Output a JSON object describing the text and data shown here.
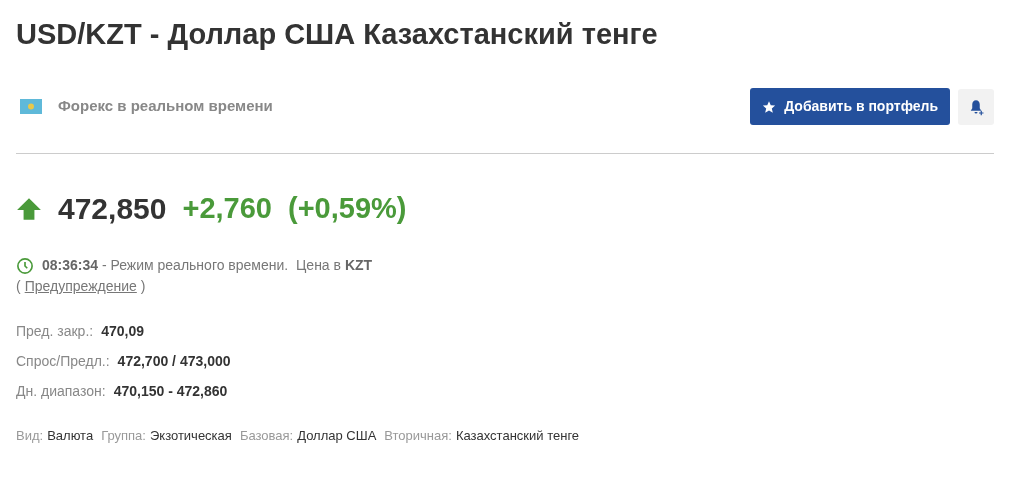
{
  "title": "USD/KZT - Доллар США Казахстанский тенге",
  "subtitle": "Форекс в реальном времени",
  "portfolio_button": "Добавить в портфель",
  "price": {
    "rising": true,
    "last": "472,850",
    "change": "+2,760",
    "change_percent": "(+0,59%)"
  },
  "status": {
    "text": "**08:36:34** - Режим реального времени.  Цена в **KZT**",
    "open_paren": "(",
    "warning_link": "Предупреждение",
    "close_paren": ")"
  },
  "stats": [
    {
      "label": "Пред. закр.:",
      "value": "470,09"
    },
    {
      "label": "Спрос/Предл.:",
      "value": "472,700 / 473,000"
    },
    {
      "label": "Дн. диапазон:",
      "value": "470,150 - 472,860"
    }
  ],
  "info": [
    {
      "label": "Вид:",
      "value": "Валюта"
    },
    {
      "label": "Группа:",
      "value": "Экзотическая"
    },
    {
      "label": "Базовая:",
      "value": "Доллар США"
    },
    {
      "label": "Вторичная:",
      "value": "Казахстанский тенге"
    }
  ]
}
